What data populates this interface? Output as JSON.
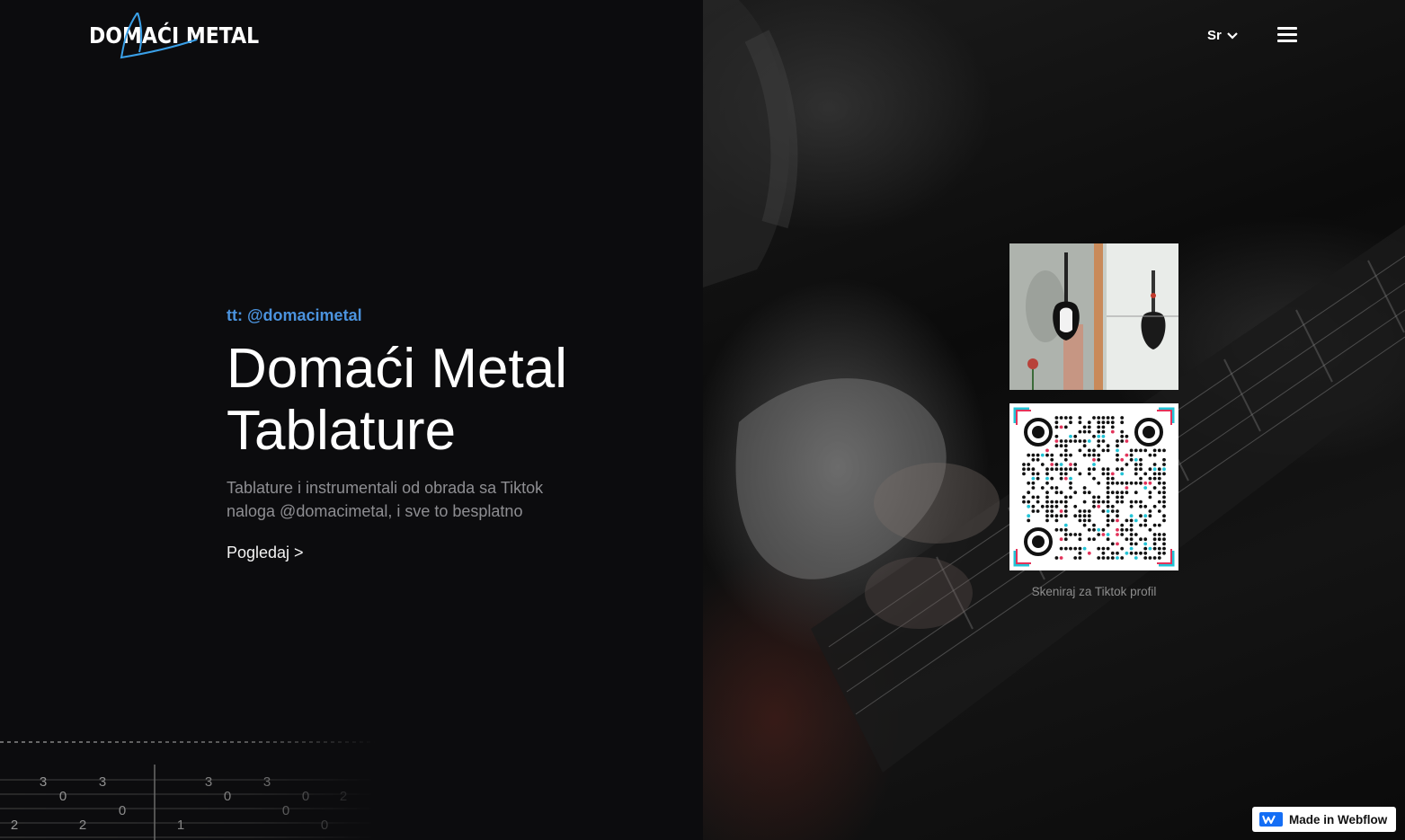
{
  "header": {
    "logo_text": "DOMAĆI METAL",
    "language": "Sr"
  },
  "hero": {
    "handle": "tt: @domacimetal",
    "title_line1": "Domaći Metal",
    "title_line2": "Tablature",
    "description": "Tablature i instrumentali od obrada sa Tiktok naloga @domacimetal, i sve to besplatno",
    "cta": "Pogledaj >"
  },
  "tab_numbers": {
    "row1": [
      "3",
      "3",
      "3",
      "3"
    ],
    "row2": [
      "0",
      "0",
      "0"
    ],
    "row3": [
      "0",
      "0"
    ],
    "row4": [
      "2",
      "2",
      "1",
      "0"
    ],
    "fade": [
      "0",
      "2"
    ]
  },
  "side": {
    "qr_caption": "Skeniraj za Tiktok profil"
  },
  "badge": {
    "label": "Made in Webflow"
  },
  "colors": {
    "accent": "#4b93de",
    "background": "#0c0c0e"
  }
}
